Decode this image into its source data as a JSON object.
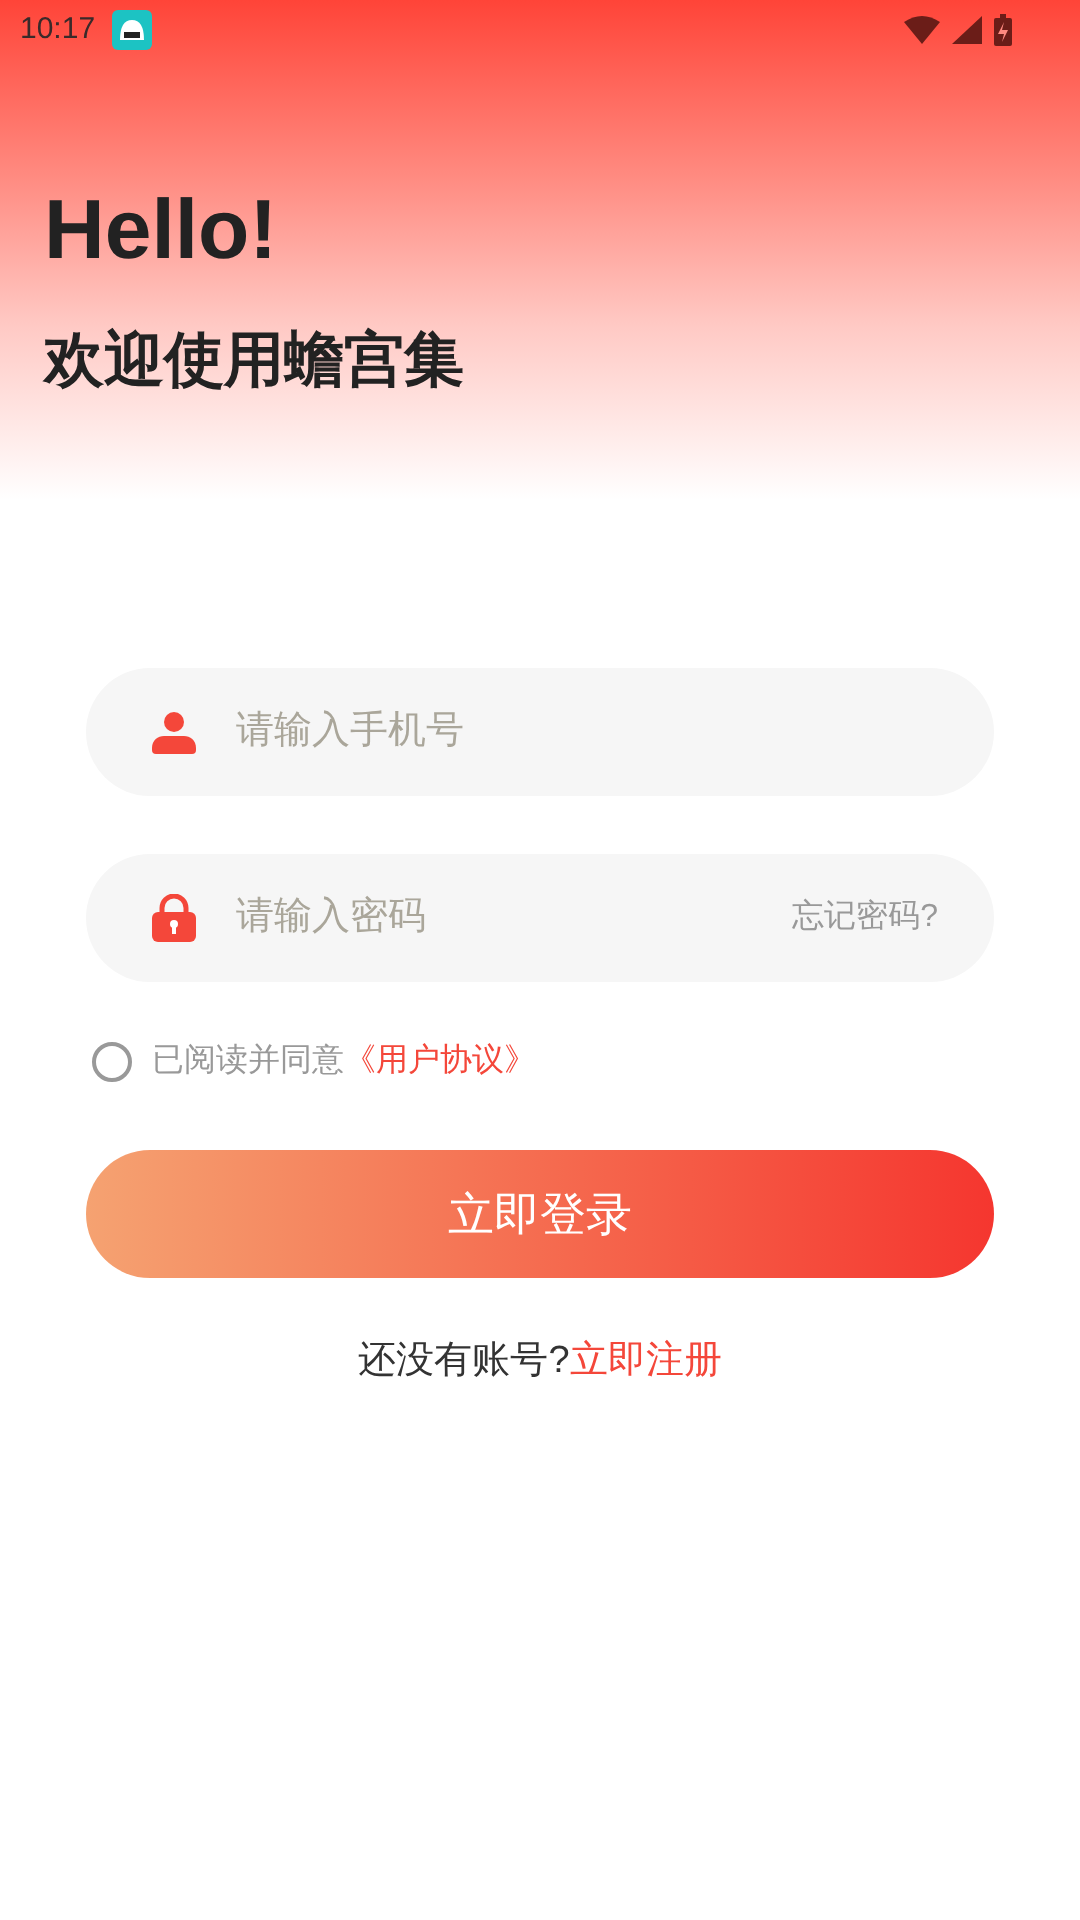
{
  "status_bar": {
    "time": "10:17"
  },
  "greeting": "Hello!",
  "subtitle": "欢迎使用蟾宫集",
  "phone_field": {
    "placeholder": "请输入手机号"
  },
  "password_field": {
    "placeholder": "请输入密码",
    "forgot_link": "忘记密码?"
  },
  "agreement": {
    "checked": false,
    "text": "已阅读并同意",
    "link": "《用户协议》"
  },
  "login_button": "立即登录",
  "register": {
    "prompt": "还没有账号?",
    "link": "立即注册"
  }
}
